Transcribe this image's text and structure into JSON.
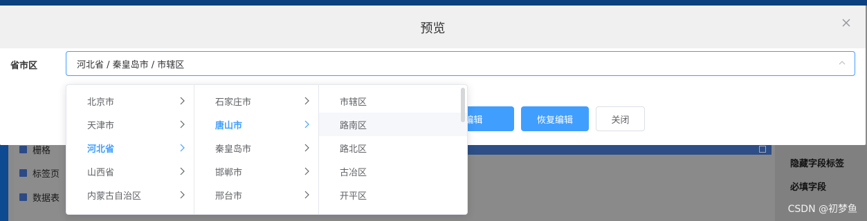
{
  "dialog": {
    "title": "预览",
    "close_icon": "close-icon"
  },
  "form": {
    "label": "省市区",
    "cascader_value": "河北省 / 秦皇岛市 / 市辖区"
  },
  "buttons": {
    "disable_edit": "禁用编辑",
    "restore_edit": "恢复编辑",
    "close": "关闭"
  },
  "cascader_menus": {
    "provinces": [
      "北京市",
      "天津市",
      "河北省",
      "山西省",
      "内蒙古自治区"
    ],
    "cities": [
      "石家庄市",
      "唐山市",
      "秦皇岛市",
      "邯郸市",
      "邢台市"
    ],
    "districts": [
      "市辖区",
      "路南区",
      "路北区",
      "古冶区",
      "开平区"
    ],
    "active_province": "河北省",
    "active_city": "唐山市",
    "hover_district": "路南区"
  },
  "background": {
    "left_items": [
      "栅格",
      "标签页",
      "数据表"
    ],
    "right_items": [
      "隐藏字段标签",
      "必填字段"
    ]
  },
  "watermark": "CSDN @初梦鱼"
}
